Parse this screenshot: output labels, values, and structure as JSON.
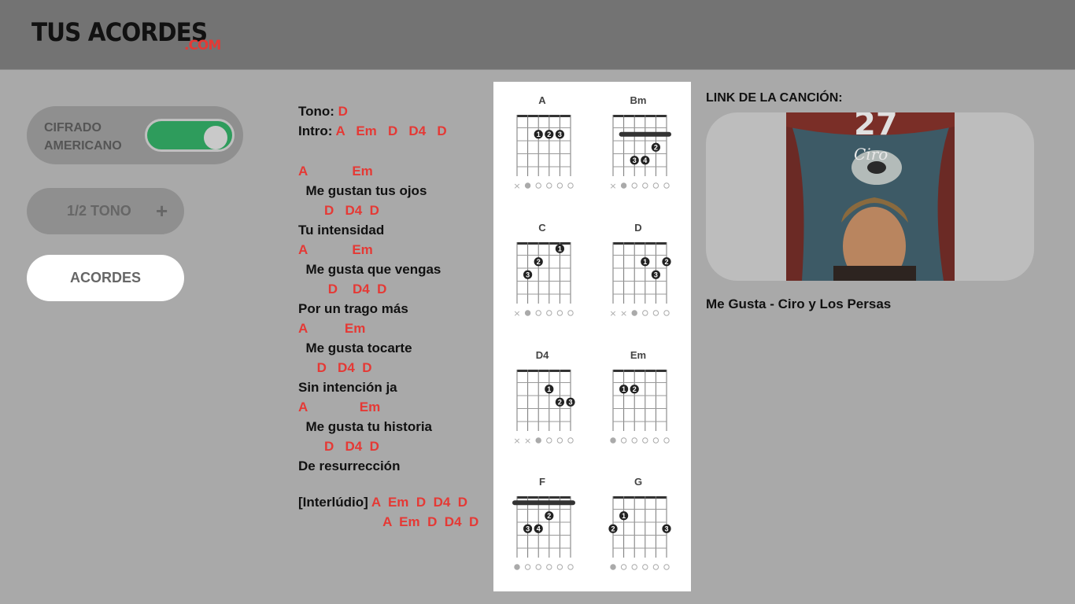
{
  "header": {
    "logo_main": "TUS ACORDES",
    "logo_suffix": ".COM"
  },
  "controls": {
    "cifrado_label": "CIFRADO AMERICANO",
    "cifrado_on": true,
    "tono_label": "1/2 TONO",
    "tono_plus": "+",
    "acordes_label": "ACORDES"
  },
  "song": {
    "tono_label": "Tono:",
    "tono_value": "D",
    "intro_label": "Intro:",
    "intro_chords": "A   Em   D   D4   D",
    "lines": [
      {
        "type": "chord",
        "text": "A            Em"
      },
      {
        "type": "lyric",
        "text": "  Me gustan tus ojos"
      },
      {
        "type": "chord",
        "text": "       D   D4  D"
      },
      {
        "type": "lyric",
        "text": "Tu intensidad"
      },
      {
        "type": "chord",
        "text": "A            Em"
      },
      {
        "type": "lyric",
        "text": "  Me gusta que vengas"
      },
      {
        "type": "chord",
        "text": "        D    D4  D"
      },
      {
        "type": "lyric",
        "text": "Por un trago más"
      },
      {
        "type": "chord",
        "text": "A          Em"
      },
      {
        "type": "lyric",
        "text": "  Me gusta tocarte"
      },
      {
        "type": "chord",
        "text": "     D   D4  D"
      },
      {
        "type": "lyric",
        "text": "Sin intención ja"
      },
      {
        "type": "chord",
        "text": "A              Em"
      },
      {
        "type": "lyric",
        "text": "  Me gusta tu historia"
      },
      {
        "type": "chord",
        "text": "       D   D4  D"
      },
      {
        "type": "lyric",
        "text": "De resurrección"
      }
    ],
    "interludio_label": "[Interlúdio]",
    "interludio_line1": " A  Em  D  D4  D",
    "interludio_line2": " A  Em  D  D4  D"
  },
  "chord_diagrams": [
    {
      "name": "A",
      "barre": null,
      "dots": [
        {
          "s": 3,
          "f": 2,
          "n": "1"
        },
        {
          "s": 4,
          "f": 2,
          "n": "2"
        },
        {
          "s": 5,
          "f": 2,
          "n": "3"
        }
      ],
      "markers": [
        "x",
        "o",
        "o",
        "o",
        "o",
        "o"
      ]
    },
    {
      "name": "Bm",
      "barre": {
        "f": 2,
        "from": 2,
        "to": 6
      },
      "dots": [
        {
          "s": 5,
          "f": 3,
          "n": "2"
        },
        {
          "s": 3,
          "f": 4,
          "n": "3"
        },
        {
          "s": 4,
          "f": 4,
          "n": "4"
        }
      ],
      "markers": [
        "x",
        "o",
        "o",
        "o",
        "o",
        "o"
      ]
    },
    {
      "name": "C",
      "barre": null,
      "dots": [
        {
          "s": 5,
          "f": 1,
          "n": "1"
        },
        {
          "s": 3,
          "f": 2,
          "n": "2"
        },
        {
          "s": 2,
          "f": 3,
          "n": "3"
        }
      ],
      "markers": [
        "x",
        "o",
        "o",
        "o",
        "o",
        "o"
      ]
    },
    {
      "name": "D",
      "barre": null,
      "dots": [
        {
          "s": 4,
          "f": 2,
          "n": "1"
        },
        {
          "s": 6,
          "f": 2,
          "n": "2"
        },
        {
          "s": 5,
          "f": 3,
          "n": "3"
        }
      ],
      "markers": [
        "x",
        "x",
        "o",
        "o",
        "o",
        "o"
      ]
    },
    {
      "name": "D4",
      "barre": null,
      "dots": [
        {
          "s": 4,
          "f": 2,
          "n": "1"
        },
        {
          "s": 5,
          "f": 3,
          "n": "2"
        },
        {
          "s": 6,
          "f": 3,
          "n": "3"
        }
      ],
      "markers": [
        "x",
        "x",
        "o",
        "o",
        "o",
        "o"
      ]
    },
    {
      "name": "Em",
      "barre": null,
      "dots": [
        {
          "s": 2,
          "f": 2,
          "n": "1"
        },
        {
          "s": 3,
          "f": 2,
          "n": "2"
        }
      ],
      "markers": [
        "o",
        "o",
        "o",
        "o",
        "o",
        "o"
      ]
    },
    {
      "name": "F",
      "barre": {
        "f": 1,
        "from": 1,
        "to": 6
      },
      "dots": [
        {
          "s": 4,
          "f": 2,
          "n": "2"
        },
        {
          "s": 2,
          "f": 3,
          "n": "3"
        },
        {
          "s": 3,
          "f": 3,
          "n": "4"
        }
      ],
      "markers": [
        "o",
        "o",
        "o",
        "o",
        "o",
        "o"
      ]
    },
    {
      "name": "G",
      "barre": null,
      "dots": [
        {
          "s": 2,
          "f": 2,
          "n": "1"
        },
        {
          "s": 1,
          "f": 3,
          "n": "2"
        },
        {
          "s": 6,
          "f": 3,
          "n": "3"
        }
      ],
      "markers": [
        "o",
        "o",
        "o",
        "o",
        "o",
        "o"
      ]
    }
  ],
  "link": {
    "title": "LINK DE LA CANCIÓN:",
    "song_title": "Me Gusta - Ciro y Los Persas",
    "thumb_text_number": "27",
    "thumb_text_name": "Ciro"
  },
  "colors": {
    "accent": "#e53935",
    "toggle_on": "#2e9c5c"
  }
}
